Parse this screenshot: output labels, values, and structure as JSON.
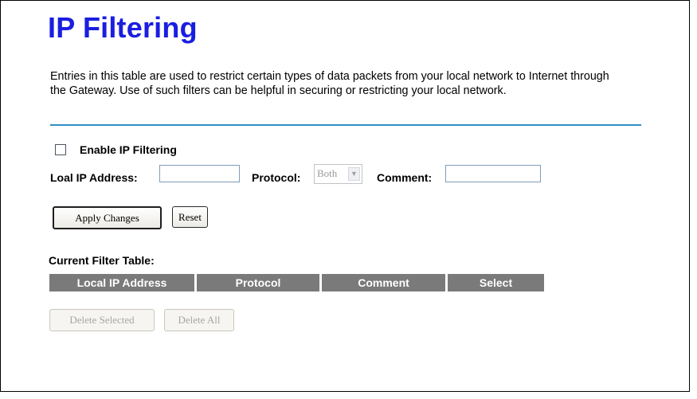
{
  "title": "IP Filtering",
  "description": "Entries in this table are used to restrict certain types of data packets from your local network to Internet through the Gateway. Use of such filters can be helpful in securing or restricting your local network.",
  "form": {
    "enable_label": "Enable IP Filtering",
    "enable_checked": false,
    "local_ip_label": "Loal IP Address:",
    "local_ip_value": "",
    "protocol_label": "Protocol:",
    "protocol_value": "Both",
    "comment_label": "Comment:",
    "comment_value": ""
  },
  "buttons": {
    "apply": "Apply Changes",
    "reset": "Reset",
    "delete_selected": "Delete Selected",
    "delete_all": "Delete All"
  },
  "table": {
    "caption": "Current Filter Table:",
    "headers": [
      "Local IP Address",
      "Protocol",
      "Comment",
      "Select"
    ],
    "rows": []
  },
  "colors": {
    "title": "#1a1ee0",
    "divider": "#2d8fc4",
    "table_header_bg": "#7a7a7a"
  }
}
